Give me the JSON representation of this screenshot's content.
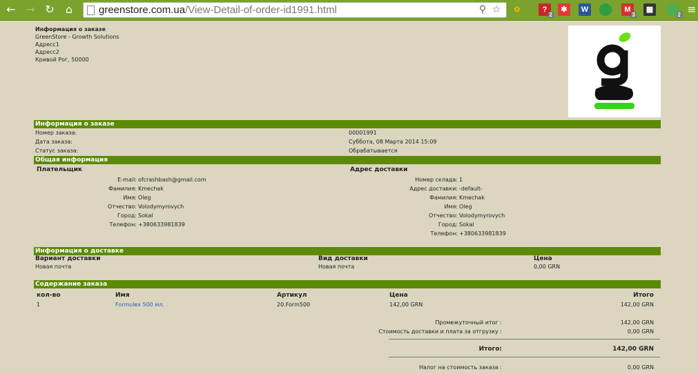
{
  "browser": {
    "url_host": "greenstore.com.ua",
    "url_path": "/View-Detail-of-order-id1991.html",
    "ext_badges": [
      "2",
      "3",
      "2"
    ],
    "ext_word": "W",
    "ext_gmail": "M"
  },
  "store": {
    "title": "Информация о заказе",
    "name": "GreenStore - Growth Solutions",
    "address1": "Адресс1",
    "address2": "Адресс2",
    "city": "Кривой Рог, 50000"
  },
  "order_info": {
    "header": "Информация о заказе",
    "rows": [
      {
        "label": "Номер заказа:",
        "value": "00001991"
      },
      {
        "label": "Дата заказа:",
        "value": "Суббота, 08 Марта 2014 15:09"
      },
      {
        "label": "Статус заказа:",
        "value": "Обрабатывается"
      }
    ]
  },
  "general": {
    "header": "Общая информация",
    "payer_title": "Плательщик",
    "payer": [
      {
        "label": "E-mail:",
        "value": "ofcrashbash@gmail.com"
      },
      {
        "label": "Фамилия:",
        "value": "Kmechak"
      },
      {
        "label": "Имя:",
        "value": "Oleg"
      },
      {
        "label": "Отчество:",
        "value": "Volodymyrovych"
      },
      {
        "label": "Город:",
        "value": "Sokal"
      },
      {
        "label": "Телефон:",
        "value": "+380633981839"
      }
    ],
    "shipping_title": "Адрес доставки",
    "shipping": [
      {
        "label": "Номер склада:",
        "value": "1"
      },
      {
        "label": "Адрес доставки:",
        "value": "-default-"
      },
      {
        "label": "Фамилия:",
        "value": "Kmechak"
      },
      {
        "label": "Имя:",
        "value": "Oleg"
      },
      {
        "label": "Отчество:",
        "value": "Volodymyrovych"
      },
      {
        "label": "Город:",
        "value": "Sokal"
      },
      {
        "label": "Телефон:",
        "value": "+380633981839"
      }
    ]
  },
  "delivery": {
    "header": "Информация о доставке",
    "col1_title": "Вариант доставки",
    "col1_value": "Новая почта",
    "col2_title": "Вид доставки",
    "col2_value": "Новая почта",
    "col3_title": "Цена",
    "col3_value": "0,00 GRN"
  },
  "contents": {
    "header": "Содержание заказа",
    "columns": {
      "qty": "кол-во",
      "name": "Имя",
      "sku": "Артикул",
      "price": "Цена",
      "total": "Итого"
    },
    "items": [
      {
        "qty": "1",
        "name": "Formulex 500 мл.",
        "sku": "20.Form500",
        "price": "142,00 GRN",
        "total": "142,00 GRN"
      }
    ],
    "subtotal_label": "Промежуточный итог :",
    "subtotal_value": "142,00 GRN",
    "shipping_label": "Стоимость доставки и плата за отгрузку :",
    "shipping_value": "0,00 GRN",
    "grand_label": "Итого:",
    "grand_value": "142,00 GRN",
    "tax_label": "Налог на стоимость заказа :",
    "tax_value": "0,00 GRN"
  }
}
